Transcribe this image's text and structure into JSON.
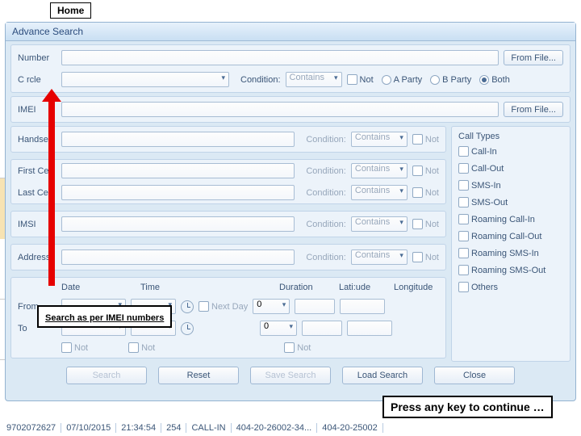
{
  "home_tab": "Home",
  "panel_title": "Advance Search",
  "labels": {
    "number": "Number",
    "circle": "C rcle",
    "imei": "IMEI",
    "handset": "Handset",
    "first_cell": "First Cell",
    "last_cell": "Last Cell",
    "imsi": "IMSI",
    "address": "Address",
    "condition": "Condition:",
    "not": "Not",
    "from_file": "From File...",
    "a_party": "A Party",
    "b_party": "B Party",
    "both": "Both",
    "contains": "Contains",
    "call_types": "Call Types",
    "date": "Date",
    "time": "Time",
    "duration": "Duration",
    "latitude": "Lati:ude",
    "longitude": "Longitude",
    "from": "From",
    "to": "To",
    "next_day": "Next Day",
    "zero": "0"
  },
  "call_types": [
    "Call-In",
    "Call-Out",
    "SMS-In",
    "SMS-Out",
    "Roaming Call-In",
    "Roaming Call-Out",
    "Roaming SMS-In",
    "Roaming SMS-Out",
    "Others"
  ],
  "buttons": {
    "search": "Search",
    "reset": "Reset",
    "save": "Save Search",
    "load": "Load Search",
    "close": "Close"
  },
  "callouts": {
    "search_imei": "Search as per IMEI numbers",
    "press_key": "Press any key to continue …"
  },
  "footer": [
    "9702072627",
    "07/10/2015",
    "21:34:54",
    "254",
    "CALL-IN",
    "404-20-26002-34...",
    "404-20-25002"
  ]
}
